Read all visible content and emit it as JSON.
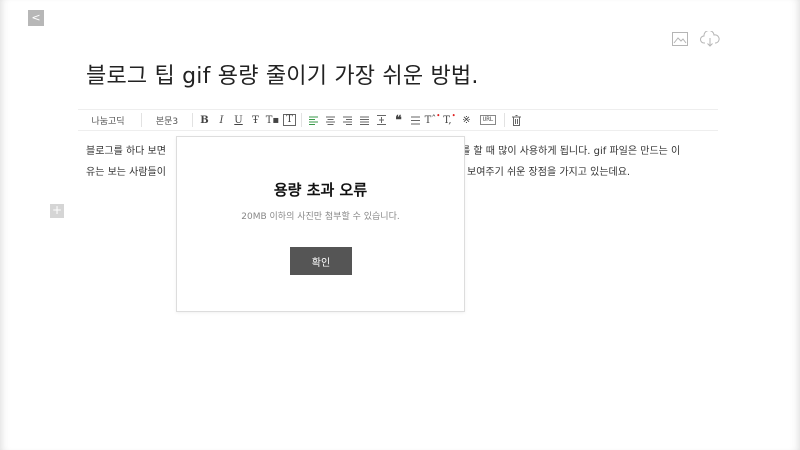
{
  "nav": {
    "back_label": "<"
  },
  "header": {
    "title": "블로그 팁 gif 용량 줄이기 가장 쉬운 방법.",
    "icons": [
      "image-icon",
      "cloud-download-icon"
    ]
  },
  "toolbar": {
    "font": "나눔고딕",
    "style": "본문3",
    "bold": "B",
    "italic": "I",
    "underline": "U",
    "strike": "Ŧ",
    "text_color": "T▪",
    "text_bg": "T",
    "quote": "❝",
    "line_height": "↕",
    "superscript": "Tˆ",
    "subscript": "T,",
    "special_char": "※",
    "url": "URL",
    "delete": "🗑"
  },
  "body": {
    "line1_left": "블로그를 하다 보면",
    "line1_right": "를 할 때 많이 사용하게 됩니다. gif 파일은 만드는 이",
    "line2_left": "유는 보는 사람들이",
    "line2_right": "보여주기 쉬운 장점을 가지고 있는데요."
  },
  "editor": {
    "add_label": "+"
  },
  "modal": {
    "title": "용량 초과 오류",
    "message": "20MB 이하의 사진만 첨부할 수 있습니다.",
    "confirm_label": "확인"
  }
}
